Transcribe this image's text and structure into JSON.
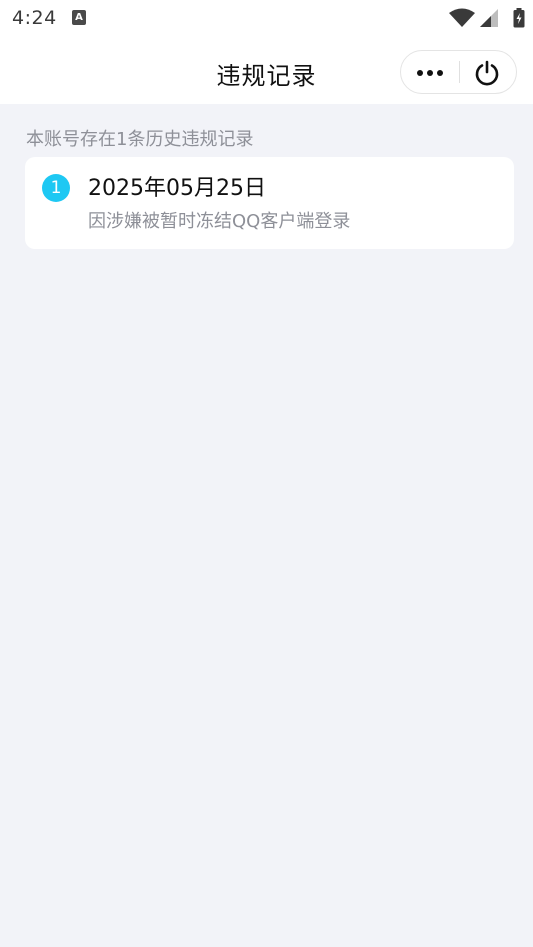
{
  "status_bar": {
    "time": "4:24",
    "notification_glyph": "A",
    "icons": [
      "wifi-icon",
      "cellular-signal-icon",
      "battery-icon"
    ]
  },
  "nav": {
    "title": "违规记录",
    "more_icon": "more-dots-icon",
    "close_icon": "power-icon"
  },
  "summary_text": "本账号存在1条历史违规记录",
  "records": [
    {
      "index": "1",
      "date": "2025年05月25日",
      "reason": "因涉嫌被暂时冻结QQ客户端登录"
    }
  ],
  "colors": {
    "badge": "#1ec8f3",
    "background": "#f2f3f8",
    "secondary_text": "#8e9098"
  }
}
